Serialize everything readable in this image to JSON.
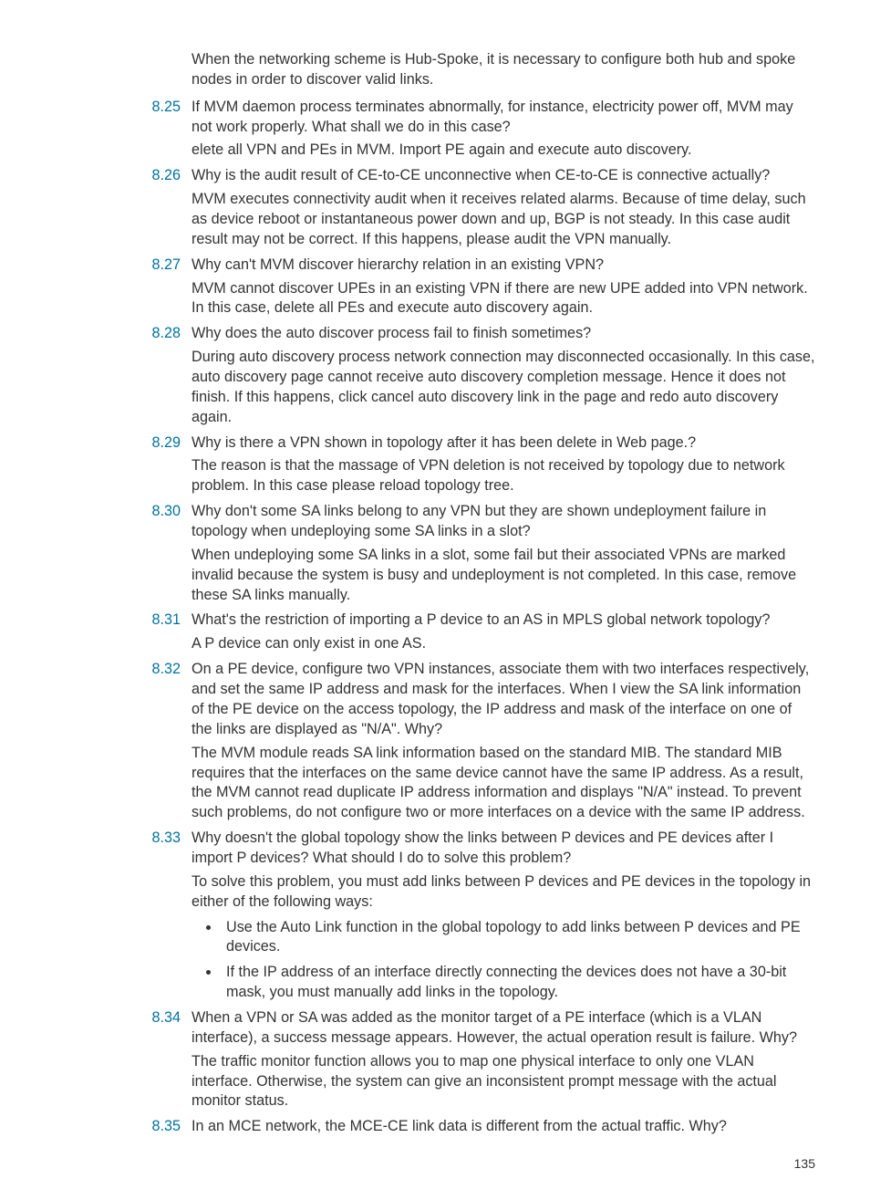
{
  "intro": "When the networking scheme is Hub-Spoke, it is necessary to configure both hub and spoke nodes in order to discover valid links.",
  "items": [
    {
      "num": "8.25",
      "q": "If MVM daemon process terminates abnormally, for instance, electricity power off, MVM may not work properly. What shall we do in this case?",
      "a": "elete all VPN and PEs in MVM. Import PE again and execute auto discovery."
    },
    {
      "num": "8.26",
      "q": "Why is the audit result of CE-to-CE unconnective when CE-to-CE is connective actually?",
      "a": "MVM executes connectivity audit when it receives related alarms. Because of time delay, such as device reboot or instantaneous power down and up, BGP is not steady. In this case audit result may not be correct. If this happens, please audit the VPN manually."
    },
    {
      "num": "8.27",
      "q": "Why can't MVM discover hierarchy relation in an existing VPN?",
      "a": "MVM cannot discover UPEs in an existing VPN if there are new UPE added into VPN network. In this case, delete all PEs and execute auto discovery again."
    },
    {
      "num": "8.28",
      "q": "Why does the auto discover process fail to finish sometimes?",
      "a": "During auto discovery process network connection may disconnected occasionally. In this case, auto discovery page cannot receive auto discovery completion message. Hence it does not finish. If this happens, click cancel auto discovery link in the page and redo auto discovery again."
    },
    {
      "num": "8.29",
      "q": "Why is there a VPN shown in topology after it has been delete in Web page.?",
      "a": "The reason is that the massage of VPN deletion is not received by topology due to network problem. In this case please reload topology tree."
    },
    {
      "num": "8.30",
      "q": "Why don't some SA links belong to any VPN but they are shown undeployment failure in topology when undeploying some SA links in a slot?",
      "a": "When undeploying some SA links in a slot, some fail but their associated VPNs are marked invalid because the system is busy and undeployment is not completed. In this case, remove these SA links manually."
    },
    {
      "num": "8.31",
      "q": "What's the restriction of importing a P device to an AS in MPLS global network topology?",
      "a": "A P device can only exist in one AS."
    },
    {
      "num": "8.32",
      "q": "On a PE device, configure two VPN instances, associate them with two interfaces respectively, and set the same IP address and mask for the interfaces. When I view the SA link information of the PE device on the access topology, the IP address and mask of the interface on one of the links are displayed as \"N/A\". Why?",
      "a": "The MVM module reads SA link information based on the standard MIB. The standard MIB requires that the interfaces on the same device cannot have the same IP address. As a result, the MVM cannot read duplicate IP address information and displays \"N/A\" instead. To prevent such problems, do not configure two or more interfaces on a device with the same IP address."
    },
    {
      "num": "8.33",
      "q": "Why doesn't the global topology show the links between P devices and PE devices after I import P devices? What should I do to solve this problem?",
      "a": "To solve this problem, you must add links between P devices and PE devices in the topology in either of the following ways:",
      "bullets": [
        "Use the Auto Link function in the global topology to add links between P devices and PE devices.",
        "If the IP address of an interface directly connecting the devices does not have a 30-bit mask, you must manually add links in the topology."
      ]
    },
    {
      "num": "8.34",
      "q": "When a VPN or SA was added as the monitor target of a PE interface (which is a VLAN interface), a success message appears. However, the actual operation result is failure. Why?",
      "a": "The traffic monitor function allows you to map one physical interface to only one VLAN interface. Otherwise, the system can give an inconsistent prompt message with the actual monitor status."
    },
    {
      "num": "8.35",
      "q": "In an MCE network, the MCE-CE link data is different from the actual traffic. Why?"
    }
  ],
  "pagenum": "135"
}
